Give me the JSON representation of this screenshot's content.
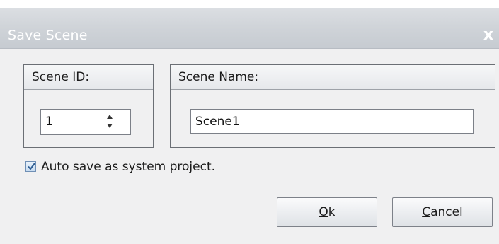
{
  "window": {
    "title": "Save Scene",
    "close_glyph": "x"
  },
  "scene_id": {
    "label": "Scene ID:",
    "value": "1"
  },
  "scene_name": {
    "label": "Scene Name:",
    "value": "Scene1"
  },
  "auto_save": {
    "label": "Auto save as system project.",
    "checked": true
  },
  "buttons": {
    "ok": {
      "mnemonic": "O",
      "rest": "k"
    },
    "cancel": {
      "mnemonic": "C",
      "rest": "ancel"
    }
  },
  "colors": {
    "titlebar": "#cfd3d8",
    "body": "#f0f0f1",
    "check_accent": "#2f5e93"
  }
}
